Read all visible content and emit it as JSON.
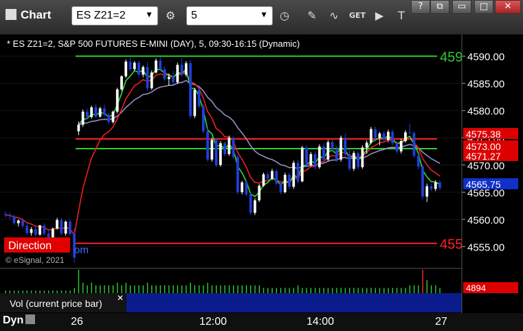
{
  "toolbar": {
    "app_title": "Chart",
    "symbol": "ES Z21=2",
    "interval": "5",
    "symbol_arrow": "▼",
    "interval_arrow": "▼",
    "buttons": [
      "settings",
      "clock",
      "draw",
      "indicators",
      "get",
      "play",
      "text-tool"
    ],
    "window_buttons": [
      "?",
      "⧉",
      "▭",
      "□",
      "✕"
    ]
  },
  "chart_data": {
    "type": "candlestick",
    "title": "* ES Z21=2, S&P 500 FUTURES E-MINI (DAY), 5, 09:30-16:15 (Dynamic)",
    "price_ticks": [
      "4590.00",
      "4585.00",
      "4580.00",
      "4575.00",
      "4570.00",
      "4565.00",
      "4560.00",
      "4555.00"
    ],
    "price_tick_values": [
      4590,
      4585,
      4580,
      4575,
      4570,
      4565,
      4560,
      4555
    ],
    "time_ticks": [
      "26",
      "12:00",
      "14:00",
      "27"
    ],
    "ylim": [
      4551,
      4594
    ],
    "price_labels": [
      {
        "text": "4575.38",
        "value": 4575.38,
        "color": "#dd0000"
      },
      {
        "text": "4573.00",
        "value": 4573.0,
        "color": "#dd0000"
      },
      {
        "text": "4571.27",
        "value": 4571.27,
        "color": "#dd0000"
      },
      {
        "text": "4565.75",
        "value": 4565.75,
        "color": "#1030c8"
      }
    ],
    "horizontal_lines": [
      {
        "value": 4590,
        "color": "#2ecc2e",
        "label": "459"
      },
      {
        "value": 4573,
        "color": "#2ecc2e"
      },
      {
        "value": 4574.8,
        "color": "#ff2020"
      },
      {
        "value": 4555.6,
        "color": "#ff2020",
        "label": "455"
      }
    ],
    "candles": [
      [
        4561.0,
        4561.5,
        4560.3,
        4560.8
      ],
      [
        4560.8,
        4561.3,
        4560.0,
        4560.6
      ],
      [
        4560.6,
        4560.9,
        4559.0,
        4559.3
      ],
      [
        4559.3,
        4560.0,
        4558.7,
        4559.8
      ],
      [
        4559.8,
        4560.2,
        4558.4,
        4558.8
      ],
      [
        4558.8,
        4559.3,
        4557.1,
        4557.5
      ],
      [
        4557.5,
        4558.6,
        4557.0,
        4558.2
      ],
      [
        4558.2,
        4558.7,
        4556.8,
        4557.2
      ],
      [
        4557.2,
        4559.0,
        4557.0,
        4558.9
      ],
      [
        4558.9,
        4559.3,
        4557.0,
        4557.4
      ],
      [
        4557.4,
        4558.0,
        4556.1,
        4556.7
      ],
      [
        4556.7,
        4558.5,
        4556.5,
        4558.3
      ],
      [
        4558.3,
        4560.3,
        4558.1,
        4559.9
      ],
      [
        4559.9,
        4560.2,
        4557.0,
        4557.4
      ],
      [
        4557.4,
        4559.8,
        4557.0,
        4559.6
      ],
      [
        4559.6,
        4560.0,
        4557.0,
        4557.3
      ],
      [
        4557.3,
        4558.4,
        4552.0,
        4553.0
      ],
      [
        4576.2,
        4578.0,
        4575.5,
        4577.4
      ],
      [
        4577.4,
        4580.2,
        4577.0,
        4579.8
      ],
      [
        4579.8,
        4580.4,
        4578.5,
        4578.8
      ],
      [
        4578.8,
        4580.9,
        4578.5,
        4580.6
      ],
      [
        4580.6,
        4581.2,
        4578.6,
        4578.9
      ],
      [
        4578.9,
        4580.7,
        4578.7,
        4580.4
      ],
      [
        4580.4,
        4581.1,
        4578.9,
        4579.2
      ],
      [
        4579.2,
        4579.6,
        4577.5,
        4577.9
      ],
      [
        4577.9,
        4580.0,
        4577.6,
        4579.8
      ],
      [
        4579.8,
        4584.2,
        4579.5,
        4583.9
      ],
      [
        4583.9,
        4586.5,
        4583.6,
        4586.3
      ],
      [
        4586.3,
        4589.4,
        4586.0,
        4589.0
      ],
      [
        4589.0,
        4589.8,
        4587.2,
        4587.6
      ],
      [
        4587.6,
        4589.1,
        4587.3,
        4588.8
      ],
      [
        4588.8,
        4589.2,
        4586.2,
        4586.6
      ],
      [
        4586.6,
        4588.3,
        4586.1,
        4588.0
      ],
      [
        4588.0,
        4588.9,
        4583.6,
        4584.1
      ],
      [
        4584.1,
        4587.4,
        4583.8,
        4587.0
      ],
      [
        4587.0,
        4589.6,
        4586.8,
        4589.2
      ],
      [
        4589.2,
        4589.8,
        4587.2,
        4587.6
      ],
      [
        4587.6,
        4588.1,
        4585.4,
        4585.8
      ],
      [
        4585.8,
        4586.8,
        4584.6,
        4586.2
      ],
      [
        4586.2,
        4587.3,
        4584.8,
        4585.2
      ],
      [
        4585.2,
        4588.8,
        4584.9,
        4588.4
      ],
      [
        4588.4,
        4589.6,
        4586.2,
        4586.6
      ],
      [
        4586.6,
        4589.1,
        4586.2,
        4588.7
      ],
      [
        4588.7,
        4589.3,
        4578.5,
        4579.0
      ],
      [
        4579.0,
        4584.2,
        4578.6,
        4583.8
      ],
      [
        4583.8,
        4584.1,
        4580.4,
        4580.8
      ],
      [
        4580.8,
        4581.2,
        4575.8,
        4576.2
      ],
      [
        4576.2,
        4577.1,
        4570.6,
        4571.0
      ],
      [
        4571.0,
        4575.0,
        4570.6,
        4574.6
      ],
      [
        4574.6,
        4575.0,
        4569.6,
        4570.0
      ],
      [
        4570.0,
        4574.4,
        4569.7,
        4574.0
      ],
      [
        4574.0,
        4574.3,
        4571.6,
        4572.0
      ],
      [
        4572.0,
        4575.4,
        4571.7,
        4575.0
      ],
      [
        4575.0,
        4575.3,
        4571.1,
        4571.5
      ],
      [
        4571.5,
        4571.8,
        4564.6,
        4565.0
      ],
      [
        4565.0,
        4567.1,
        4564.6,
        4566.8
      ],
      [
        4566.8,
        4567.1,
        4564.2,
        4564.6
      ],
      [
        4564.6,
        4565.0,
        4560.8,
        4561.2
      ],
      [
        4561.2,
        4563.9,
        4560.8,
        4563.5
      ],
      [
        4563.5,
        4566.5,
        4563.2,
        4566.2
      ],
      [
        4566.2,
        4568.6,
        4566.0,
        4568.3
      ],
      [
        4568.3,
        4568.8,
        4567.1,
        4567.5
      ],
      [
        4567.5,
        4569.3,
        4567.2,
        4568.9
      ],
      [
        4568.9,
        4569.2,
        4566.2,
        4566.6
      ],
      [
        4566.6,
        4567.1,
        4564.6,
        4565.0
      ],
      [
        4565.0,
        4568.6,
        4564.8,
        4568.2
      ],
      [
        4568.2,
        4568.6,
        4565.6,
        4566.0
      ],
      [
        4566.0,
        4570.8,
        4565.6,
        4570.4
      ],
      [
        4570.4,
        4571.0,
        4566.6,
        4567.0
      ],
      [
        4567.0,
        4573.5,
        4566.8,
        4573.2
      ],
      [
        4573.2,
        4573.7,
        4569.6,
        4570.0
      ],
      [
        4570.0,
        4572.4,
        4569.7,
        4572.0
      ],
      [
        4572.0,
        4572.5,
        4569.2,
        4569.6
      ],
      [
        4569.6,
        4573.8,
        4569.3,
        4573.4
      ],
      [
        4573.4,
        4574.0,
        4570.6,
        4571.0
      ],
      [
        4571.0,
        4574.6,
        4570.7,
        4574.2
      ],
      [
        4574.2,
        4574.7,
        4572.6,
        4573.0
      ],
      [
        4573.0,
        4573.5,
        4570.6,
        4571.0
      ],
      [
        4571.0,
        4575.4,
        4570.6,
        4575.0
      ],
      [
        4575.0,
        4575.8,
        4571.6,
        4572.0
      ],
      [
        4572.0,
        4572.8,
        4568.9,
        4569.3
      ],
      [
        4569.3,
        4572.6,
        4568.9,
        4572.2
      ],
      [
        4572.2,
        4572.6,
        4569.2,
        4569.6
      ],
      [
        4569.6,
        4573.6,
        4569.3,
        4573.2
      ],
      [
        4573.2,
        4574.5,
        4572.1,
        4574.1
      ],
      [
        4574.1,
        4577.0,
        4573.8,
        4576.6
      ],
      [
        4576.6,
        4577.1,
        4574.6,
        4575.0
      ],
      [
        4575.0,
        4576.1,
        4573.6,
        4575.8
      ],
      [
        4575.8,
        4576.2,
        4574.2,
        4574.6
      ],
      [
        4574.6,
        4576.5,
        4574.2,
        4576.1
      ],
      [
        4576.1,
        4576.5,
        4573.6,
        4574.0
      ],
      [
        4574.0,
        4574.4,
        4572.1,
        4572.5
      ],
      [
        4572.5,
        4574.8,
        4572.1,
        4574.4
      ],
      [
        4574.4,
        4576.4,
        4574.1,
        4576.0
      ],
      [
        4576.0,
        4577.6,
        4575.6,
        4575.9
      ],
      [
        4575.9,
        4576.2,
        4571.3,
        4571.7
      ],
      [
        4571.7,
        4572.1,
        4569.2,
        4569.7
      ],
      [
        4569.7,
        4570.1,
        4563.6,
        4564.2
      ],
      [
        4564.2,
        4566.6,
        4563.2,
        4566.1
      ],
      [
        4566.1,
        4566.5,
        4565.2,
        4565.6
      ],
      [
        4565.6,
        4567.2,
        4565.2,
        4566.8
      ],
      [
        4566.8,
        4567.2,
        4565.4,
        4565.75
      ]
    ],
    "volume_label": "Vol (current price bar)",
    "volume_value": "4894",
    "volumes": [
      1,
      1,
      1,
      1,
      1,
      1,
      1,
      1,
      1,
      1,
      1,
      1,
      1,
      1,
      1,
      1,
      2,
      9,
      4,
      3,
      4,
      3,
      3,
      3,
      3,
      3,
      4,
      3,
      4,
      3,
      3,
      3,
      3,
      4,
      3,
      3,
      3,
      3,
      3,
      3,
      3,
      3,
      3,
      4,
      3,
      3,
      3,
      4,
      3,
      3,
      3,
      3,
      3,
      3,
      3,
      3,
      3,
      3,
      3,
      3,
      2,
      2,
      2,
      2,
      2,
      2,
      2,
      2,
      3,
      2,
      2,
      2,
      2,
      2,
      2,
      2,
      2,
      2,
      2,
      2,
      2,
      2,
      2,
      2,
      2,
      2,
      2,
      2,
      2,
      2,
      2,
      2,
      2,
      2,
      3,
      3,
      3,
      9,
      5,
      3,
      3,
      2
    ],
    "overlay_text": {
      "direction_label": "Direction",
      "copyright": "© eSignal, 2021",
      "partial_link": "om"
    },
    "colors": {
      "up": "#ffffff",
      "down": "#1f3fdc",
      "green_ma": "#33dd33",
      "red_ma": "#ee2020",
      "purple_ma": "#9a8cc8",
      "volume": "#30d030",
      "volume_spike": "#ff3030"
    }
  },
  "footer": {
    "dyn_label": "Dyn"
  }
}
